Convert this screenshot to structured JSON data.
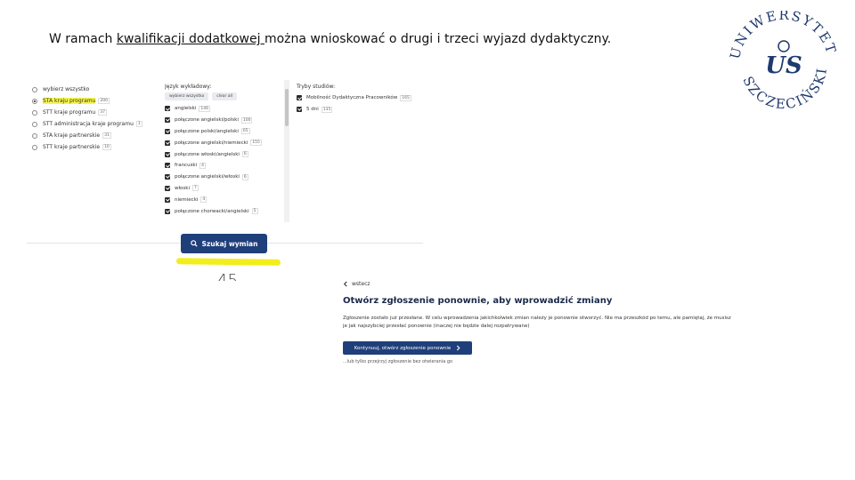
{
  "slide": {
    "title_pre": "W ramach ",
    "title_link": "kwalifikacji dodatkowej ",
    "title_post": "można wnioskować o drugi i trzeci wyjazd dydaktyczny."
  },
  "logo": {
    "ring_text": "UNIWERSYTET SZCZECIŃSKI",
    "monogram": "US",
    "color": "#1f3a6e"
  },
  "screenshot1": {
    "programs": [
      {
        "label": "wybierz wszystko",
        "count": "",
        "selected": false,
        "highlight": false
      },
      {
        "label": "STA kraju programu",
        "count": "200",
        "selected": true,
        "highlight": true
      },
      {
        "label": "STT kraje programu",
        "count": "37",
        "selected": false,
        "highlight": false
      },
      {
        "label": "STT administracja kraje programu",
        "count": "1",
        "selected": false,
        "highlight": false
      },
      {
        "label": "STA kraje partnerskie",
        "count": "31",
        "selected": false,
        "highlight": false
      },
      {
        "label": "STT kraje partnerskie",
        "count": "10",
        "selected": false,
        "highlight": false
      }
    ],
    "languages_header": "Język wykładowy:",
    "select_all_label": "wybierz wszystko",
    "clear_all_label": "clear all",
    "languages": [
      {
        "label": "angielski",
        "count": "146"
      },
      {
        "label": "połączone angielski/polski",
        "count": "100"
      },
      {
        "label": "połączone polski/angielski",
        "count": "65"
      },
      {
        "label": "połączone angielski/niemiecki",
        "count": "155"
      },
      {
        "label": "połączone włoski/angielski",
        "count": "6"
      },
      {
        "label": "francuski",
        "count": "4"
      },
      {
        "label": "połączone angielski/włoski",
        "count": "6"
      },
      {
        "label": "włoski",
        "count": "7"
      },
      {
        "label": "niemiecki",
        "count": "4"
      },
      {
        "label": "połączone chorwacki/angielski",
        "count": "5"
      }
    ],
    "modes_header": "Tryby studiów:",
    "modes": [
      {
        "label": "Mobilność Dydaktyczna Pracowników",
        "count": "165"
      },
      {
        "label": "5 dni",
        "count": "135"
      }
    ],
    "search_button": "Szukaj wymian",
    "search_icon": "search-icon",
    "partial_number": "45",
    "accent": "#1f3f7a",
    "highlight_color": "#f2ee1c"
  },
  "screenshot2": {
    "back_label": "wstecz",
    "title": "Otwórz zgłoszenie ponownie, aby wprowadzić zmiany",
    "text": "Zgłoszenie zostało już przesłane. W celu wprowadzenia jakichkolwiek zmian należy je ponownie otworzyć. Nie ma przeszkód po temu, ale pamiętaj, że musisz je jak najszybciej przesłać ponownie (inaczej nie będzie dalej rozpatrywane)",
    "button_label": "Kontynuuj, otwórz zgłoszenie ponownie",
    "note": "...lub tylko przejrzyj zgłoszenie bez otwierania go"
  }
}
